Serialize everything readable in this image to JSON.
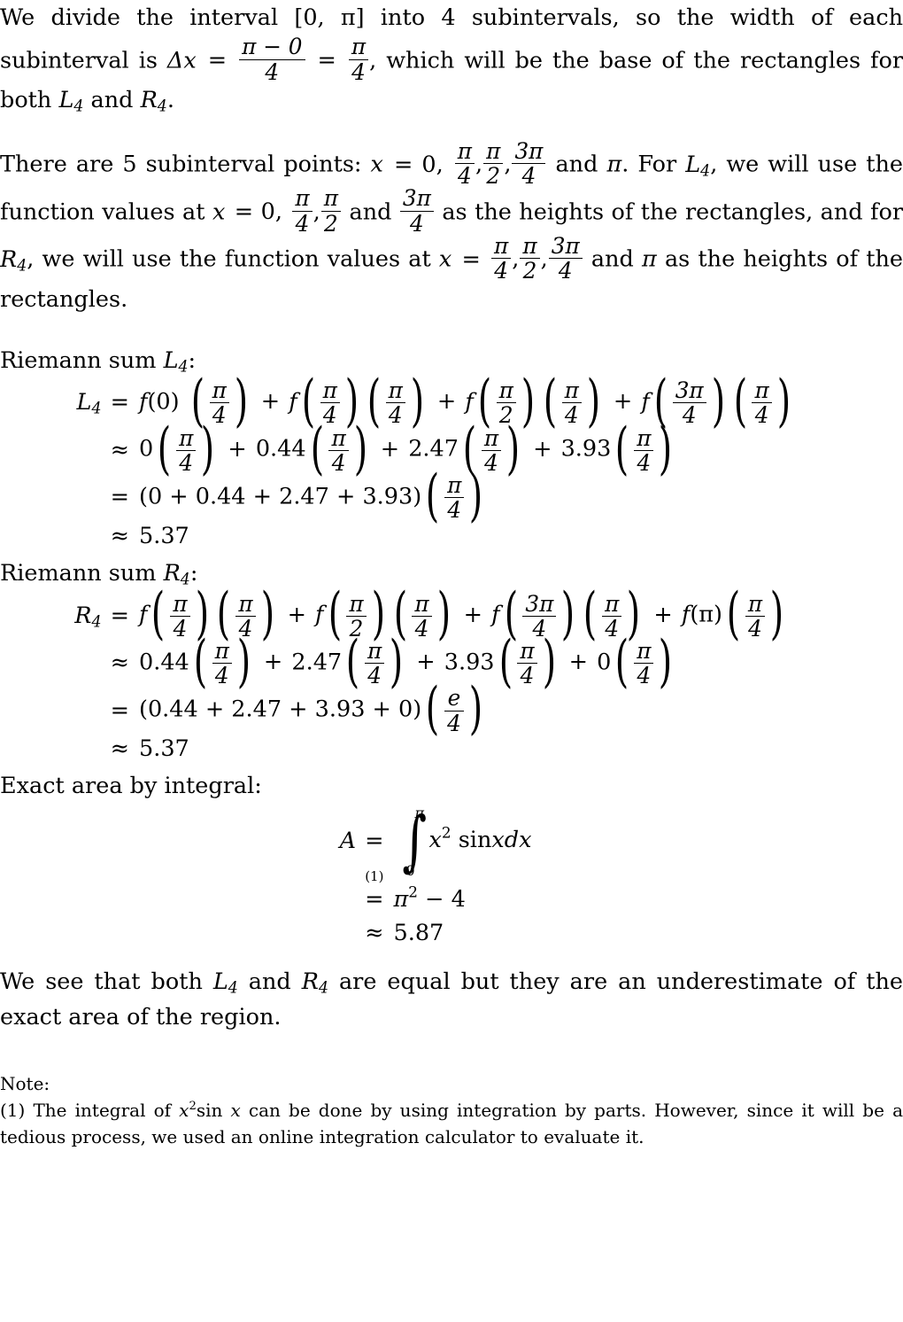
{
  "document": {
    "type": "calculus-solution",
    "topic": "Riemann sums L4 and R4 for the area under x^2 sin x on [0, pi]"
  },
  "intro": {
    "p1_a": "We divide the interval ",
    "p1_interval": "[0, π]",
    "p1_b": " into 4 subintervals, so the width of each subinterval is ",
    "p1_deltax": "Δx",
    "p1_eq": "=",
    "p1_frac1_num": "π − 0",
    "p1_frac1_den": "4",
    "p1_eq2": "=",
    "p1_frac2_num": "π",
    "p1_frac2_den": "4",
    "p1_c": ", which will be the base of the rectangles for both ",
    "p1_L": "L",
    "p1_L_sub": "4",
    "p1_d": " and ",
    "p1_R": "R",
    "p1_R_sub": "4",
    "p1_e": "."
  },
  "points": {
    "p2_a": "There are 5 subinterval points: ",
    "p2_x": "x",
    "p2_eq": "= 0,",
    "p2_f1_num": "π",
    "p2_f1_den": "4",
    "p2_comma1": ",",
    "p2_f2_num": "π",
    "p2_f2_den": "2",
    "p2_comma2": ",",
    "p2_f3_num": "3π",
    "p2_f3_den": "4",
    "p2_b": " and ",
    "p2_pi": "π",
    "p2_c": ". For ",
    "p2_L": "L",
    "p2_L_sub": "4",
    "p2_d": ", we will use the function values at ",
    "p2_x2": "x",
    "p2_eq2": "= 0,",
    "p2_f4_num": "π",
    "p2_f4_den": "4",
    "p2_comma3": ",",
    "p2_f5_num": "π",
    "p2_f5_den": "2",
    "p2_e": " and ",
    "p2_f6_num": "3π",
    "p2_f6_den": "4",
    "p2_f": " as the heights of the rectangles, and for ",
    "p2_R": "R",
    "p2_R_sub": "4",
    "p2_g": ", we will use the function values at ",
    "p2_x3": "x",
    "p2_eq3": "=",
    "p2_f7_num": "π",
    "p2_f7_den": "4",
    "p2_comma4": ",",
    "p2_f8_num": "π",
    "p2_f8_den": "2",
    "p2_comma5": ",",
    "p2_f9_num": "3π",
    "p2_f9_den": "4",
    "p2_h": " and ",
    "p2_pi2": "π",
    "p2_i": " as the heights of the rectangles."
  },
  "left_sum": {
    "heading_text": "Riemann sum ",
    "heading_sym": "L",
    "heading_sub": "4",
    "heading_colon": ":",
    "line1": {
      "lhs_sym": "L",
      "lhs_sub": "4",
      "op": "=",
      "f1": "f",
      "f1_arg": "(0)",
      "t1_num": "π",
      "t1_den": "4",
      "plus1": "+",
      "f2": "f",
      "f2_num": "π",
      "f2_den": "4",
      "t2_num": "π",
      "t2_den": "4",
      "plus2": "+",
      "f3": "f",
      "f3_num": "π",
      "f3_den": "2",
      "t3_num": "π",
      "t3_den": "4",
      "plus3": "+",
      "f4": "f",
      "f4_num": "3π",
      "f4_den": "4",
      "t4_num": "π",
      "t4_den": "4"
    },
    "line2": {
      "op": "≈",
      "v1": "0",
      "t1_num": "π",
      "t1_den": "4",
      "plus1": "+",
      "v2": "0.44",
      "t2_num": "π",
      "t2_den": "4",
      "plus2": "+",
      "v3": "2.47",
      "t3_num": "π",
      "t3_den": "4",
      "plus3": "+",
      "v4": "3.93",
      "t4_num": "π",
      "t4_den": "4"
    },
    "line3": {
      "op": "=",
      "sum_text": "(0 + 0.44 + 2.47 + 3.93)",
      "t_num": "π",
      "t_den": "4"
    },
    "line4": {
      "op": "≈",
      "value": "5.37"
    }
  },
  "right_sum": {
    "heading_text": "Riemann sum ",
    "heading_sym": "R",
    "heading_sub": "4",
    "heading_colon": ":",
    "line1": {
      "lhs_sym": "R",
      "lhs_sub": "4",
      "op": "=",
      "f1": "f",
      "f1_num": "π",
      "f1_den": "4",
      "t1_num": "π",
      "t1_den": "4",
      "plus1": "+",
      "f2": "f",
      "f2_num": "π",
      "f2_den": "2",
      "t2_num": "π",
      "t2_den": "4",
      "plus2": "+",
      "f3": "f",
      "f3_num": "3π",
      "f3_den": "4",
      "t3_num": "π",
      "t3_den": "4",
      "plus3": "+",
      "f4": "f",
      "f4_arg": "(π)",
      "t4_num": "π",
      "t4_den": "4"
    },
    "line2": {
      "op": "≈",
      "v1": "0.44",
      "t1_num": "π",
      "t1_den": "4",
      "plus1": "+",
      "v2": "2.47",
      "t2_num": "π",
      "t2_den": "4",
      "plus2": "+",
      "v3": "3.93",
      "t3_num": "π",
      "t3_den": "4",
      "plus3": "+",
      "v4": "0",
      "t4_num": "π",
      "t4_den": "4"
    },
    "line3": {
      "op": "=",
      "sum_text": "(0.44 + 2.47 + 3.93 + 0)",
      "t_num": "e",
      "t_den": "4"
    },
    "line4": {
      "op": "≈",
      "value": "5.37"
    }
  },
  "exact": {
    "heading": "Exact area by integral:",
    "line1": {
      "lhs": "A",
      "op": "=",
      "int_upper": "π",
      "int_lower": "0",
      "integrand_x": "x",
      "integrand_exp": "2",
      "integrand_rest": "sin",
      "integrand_var": "x",
      "differential": "dx"
    },
    "line2": {
      "op": "=",
      "note_tag": "(1)",
      "pi": "π",
      "exp": "2",
      "minus": "− 4"
    },
    "line3": {
      "op": "≈",
      "value": "5.87"
    }
  },
  "conclusion": {
    "a": "We see that both ",
    "L": "L",
    "L_sub": "4",
    "b": " and ",
    "R": "R",
    "R_sub": "4",
    "c": " are equal but they are an underestimate of the exact area of the region."
  },
  "note": {
    "head": "Note:",
    "marker": "(1)",
    "a": " The integral of ",
    "x": "x",
    "x_exp": "2",
    "sinx_sin": "sin ",
    "sinx_x": "x",
    "b": " can be done by using integration by parts. However, since it will be a tedious process, we used an online integration calculator to evaluate it."
  }
}
